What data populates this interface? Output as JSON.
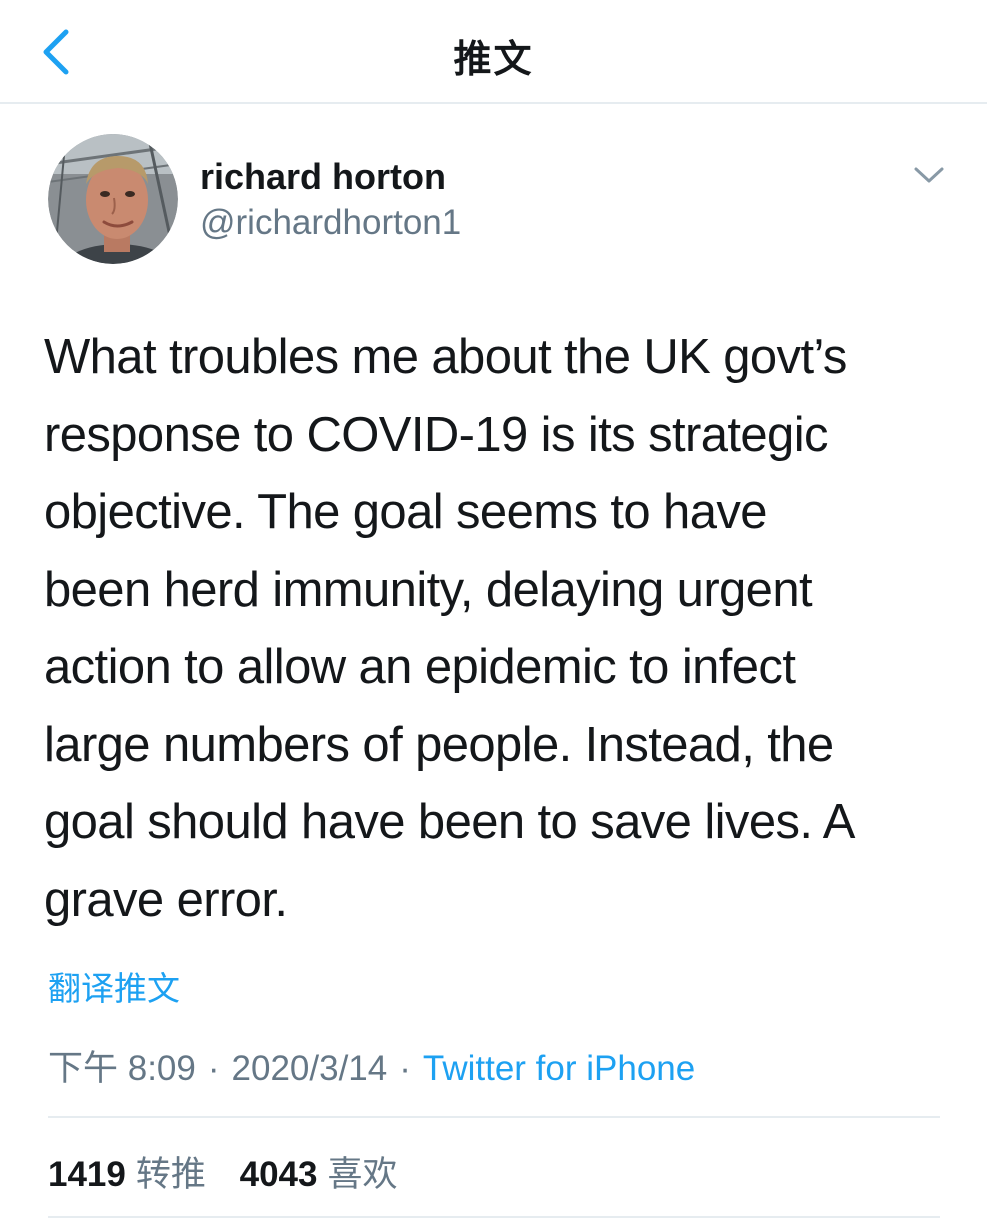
{
  "nav": {
    "title": "推文",
    "accent_color": "#1da1f2"
  },
  "author": {
    "name": "richard horton",
    "handle": "@richardhorton1"
  },
  "tweet": {
    "text": "What troubles me about the UK govt’s\nresponse to COVID-19 is its strategic\nobjective. The goal seems to have\nbeen herd immunity, delaying urgent\naction to allow an epidemic to infect\nlarge numbers of people. Instead, the\ngoal should have been to save lives. A\ngrave error.",
    "translate_label": "翻译推文",
    "time": "下午 8:09",
    "date": "2020/3/14",
    "separator": "·",
    "source": "Twitter for iPhone"
  },
  "stats": {
    "retweets": {
      "count": "1419",
      "label": "转推"
    },
    "likes": {
      "count": "4043",
      "label": "喜欢"
    }
  },
  "icons": {
    "back": "chevron-left-icon",
    "more": "chevron-down-icon"
  },
  "colors": {
    "text_primary": "#14171a",
    "text_secondary": "#657786",
    "link": "#1da1f2",
    "divider": "#e6ecf0"
  }
}
